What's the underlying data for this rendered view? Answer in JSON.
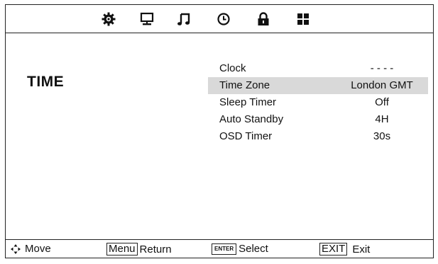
{
  "tabs": [
    {
      "icon": "picture-gear-icon"
    },
    {
      "icon": "monitor-icon"
    },
    {
      "icon": "music-note-icon"
    },
    {
      "icon": "clock-icon"
    },
    {
      "icon": "lock-icon"
    },
    {
      "icon": "grid-icon"
    }
  ],
  "section_title": "TIME",
  "menu": [
    {
      "label": "Clock",
      "value": "- - - -"
    },
    {
      "label": "Time Zone",
      "value": "London GMT",
      "selected": true
    },
    {
      "label": "Sleep Timer",
      "value": "Off"
    },
    {
      "label": "Auto Standby",
      "value": "4H"
    },
    {
      "label": "OSD Timer",
      "value": "30s"
    }
  ],
  "footer": {
    "move_label": "Move",
    "menu_key": "Menu",
    "return_label": "Return",
    "enter_key": "ENTER",
    "select_label": "Select",
    "exit_key": "EXIT",
    "exit_label": "Exit"
  }
}
